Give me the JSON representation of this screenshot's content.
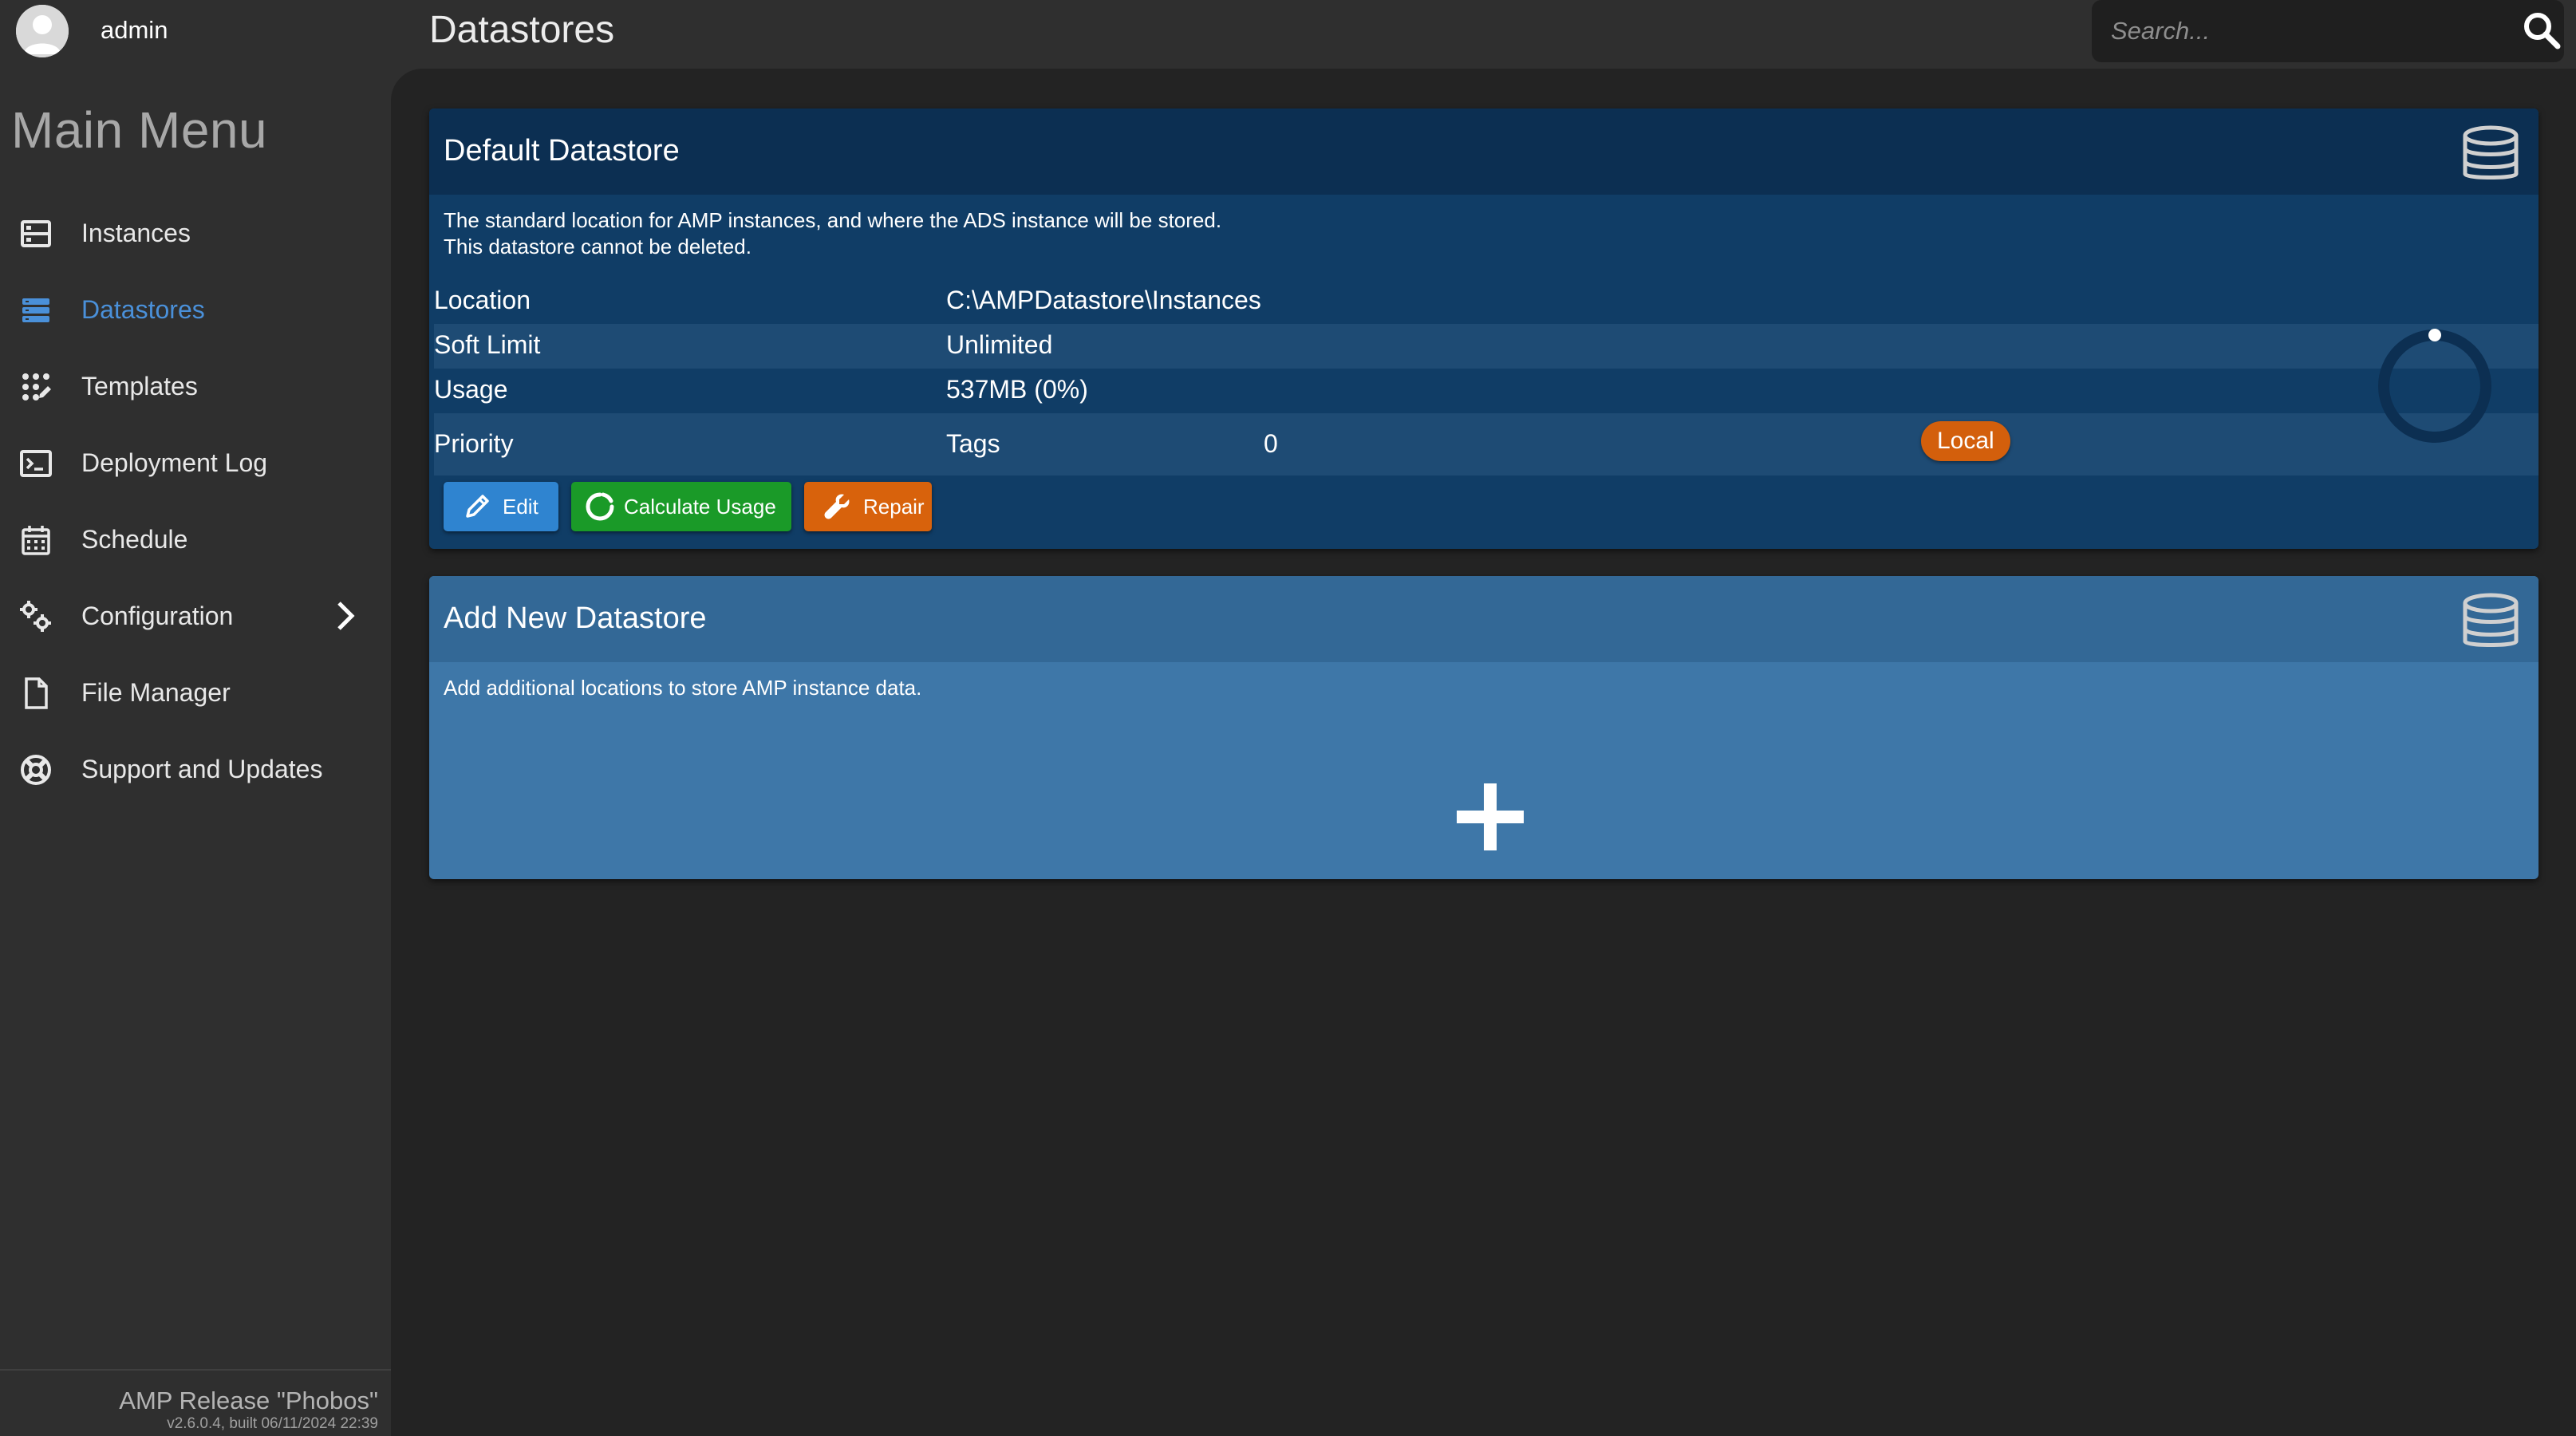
{
  "user": {
    "name": "admin"
  },
  "sidebar": {
    "menu_title": "Main Menu",
    "items": [
      {
        "label": "Instances",
        "icon": "instances-icon",
        "active": false
      },
      {
        "label": "Datastores",
        "icon": "datastores-icon",
        "active": true
      },
      {
        "label": "Templates",
        "icon": "templates-icon",
        "active": false
      },
      {
        "label": "Deployment Log",
        "icon": "terminal-icon",
        "active": false
      },
      {
        "label": "Schedule",
        "icon": "calendar-icon",
        "active": false
      },
      {
        "label": "Configuration",
        "icon": "gears-icon",
        "active": false,
        "has_submenu": true
      },
      {
        "label": "File Manager",
        "icon": "file-icon",
        "active": false
      },
      {
        "label": "Support and Updates",
        "icon": "lifebuoy-icon",
        "active": false
      }
    ],
    "footer": {
      "release": "AMP Release \"Phobos\"",
      "version": "v2.6.0.4, built 06/11/2024 22:39"
    }
  },
  "header": {
    "title": "Datastores",
    "search_placeholder": "Search..."
  },
  "datastores": [
    {
      "title": "Default Datastore",
      "description_line1": "The standard location for AMP instances, and where the ADS instance will be stored.",
      "description_line2": "This datastore cannot be deleted.",
      "location_label": "Location",
      "location": "C:\\AMPDatastore\\Instances",
      "soft_limit_label": "Soft Limit",
      "soft_limit": "Unlimited",
      "usage_label": "Usage",
      "usage": "537MB (0%)",
      "usage_fraction": 0.0,
      "priority_label": "Priority",
      "priority": "0",
      "tags_label": "Tags",
      "tags": [
        "Local"
      ],
      "buttons": {
        "edit": "Edit",
        "calculate": "Calculate Usage",
        "repair": "Repair"
      }
    }
  ],
  "add_new": {
    "title": "Add New Datastore",
    "description": "Add additional locations to store AMP instance data."
  },
  "colors": {
    "accent": "#4a90d9",
    "sidebar_bg": "#2f2f2f",
    "page_bg": "#232323",
    "card_bg": "#103d66",
    "card_header": "#0c2f52",
    "add_card_bg": "#3e77a8",
    "edit_button": "#2f84d0",
    "calculate_button": "#1a9a28",
    "repair_button": "#d8620c",
    "tag": "#d35f0c"
  }
}
